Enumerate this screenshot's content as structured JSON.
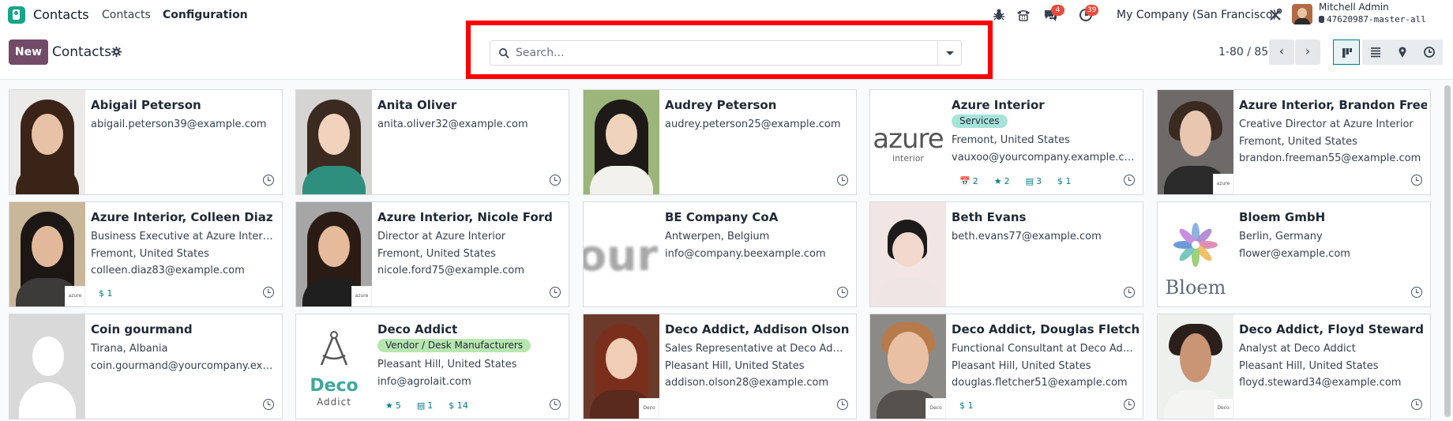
{
  "navbar": {
    "app_name": "Contacts",
    "menu": [
      "Contacts",
      "Configuration"
    ],
    "icons": [
      "bug-icon",
      "phone-icon",
      "chat-icon",
      "activity-clock-icon",
      "tools-icon"
    ],
    "chat_badge": "4",
    "activity_badge": "39",
    "company": "My Company (San Francisco)",
    "user_name": "Mitchell Admin",
    "database": "47620987-master-all"
  },
  "control_panel": {
    "new_label": "New",
    "breadcrumb": "Contacts",
    "search_placeholder": "Search...",
    "pager": "1-80 / 85",
    "accent": "#714b67"
  },
  "contacts": [
    {
      "name": "Abigail Peterson",
      "lines": [
        "abigail.peterson39@example.com"
      ],
      "tag": "",
      "stats": []
    },
    {
      "name": "Anita Oliver",
      "lines": [
        "anita.oliver32@example.com"
      ],
      "tag": "",
      "stats": []
    },
    {
      "name": "Audrey Peterson",
      "lines": [
        "audrey.peterson25@example.com"
      ],
      "tag": "",
      "stats": []
    },
    {
      "name": "Azure Interior",
      "tag": "Services",
      "lines": [
        "Fremont, United States",
        "vauxoo@yourcompany.example.com"
      ],
      "stats": [
        "2",
        "2",
        "3",
        "$ 1"
      ]
    },
    {
      "name": "Azure Interior, Brandon Freeman",
      "lines": [
        "Creative Director at Azure Interior",
        "Fremont, United States",
        "brandon.freeman55@example.com"
      ],
      "tag": "",
      "stats": []
    },
    {
      "name": "Azure Interior, Colleen Diaz",
      "lines": [
        "Business Executive at Azure Interior",
        "Fremont, United States",
        "colleen.diaz83@example.com"
      ],
      "tag": "",
      "stats": [
        "$ 1"
      ]
    },
    {
      "name": "Azure Interior, Nicole Ford",
      "lines": [
        "Director at Azure Interior",
        "Fremont, United States",
        "nicole.ford75@example.com"
      ],
      "tag": "",
      "stats": []
    },
    {
      "name": "BE Company CoA",
      "lines": [
        "Antwerpen, Belgium",
        "info@company.beexample.com"
      ],
      "tag": "",
      "stats": []
    },
    {
      "name": "Beth Evans",
      "lines": [
        "beth.evans77@example.com"
      ],
      "tag": "",
      "stats": []
    },
    {
      "name": "Bloem GmbH",
      "lines": [
        "Berlin, Germany",
        "flower@example.com"
      ],
      "tag": "",
      "stats": []
    },
    {
      "name": "Coin gourmand",
      "lines": [
        "Tirana, Albania",
        "coin.gourmand@yourcompany.example.com"
      ],
      "tag": "",
      "stats": []
    },
    {
      "name": "Deco Addict",
      "tag": "Vendor / Desk Manufacturers",
      "lines": [
        "Pleasant Hill, United States",
        "info@agrolait.com"
      ],
      "stats": [
        "5",
        "1",
        "$ 14"
      ]
    },
    {
      "name": "Deco Addict, Addison Olson",
      "lines": [
        "Sales Representative at Deco Addict",
        "Pleasant Hill, United States",
        "addison.olson28@example.com"
      ],
      "tag": "",
      "stats": []
    },
    {
      "name": "Deco Addict, Douglas Fletcher",
      "lines": [
        "Functional Consultant at Deco Addict",
        "Pleasant Hill, United States",
        "douglas.fletcher51@example.com"
      ],
      "tag": "",
      "stats": [
        "$ 1"
      ]
    },
    {
      "name": "Deco Addict, Floyd Steward",
      "lines": [
        "Analyst at Deco Addict",
        "Pleasant Hill, United States",
        "floyd.steward34@example.com"
      ],
      "tag": "",
      "stats": []
    }
  ],
  "logos": {
    "azure": "azure",
    "azure_sub": "interior",
    "be_company": "our",
    "bloem": "Bloem",
    "deco": "Deco",
    "deco_sub": "Addict",
    "mini_azure": "azure",
    "mini_deco": "Deco"
  },
  "tag_colors": {
    "Services": "#a6e3d9",
    "Vendor / Desk Manufacturers": "#b8e6b0"
  },
  "stat_color": "#017e84"
}
